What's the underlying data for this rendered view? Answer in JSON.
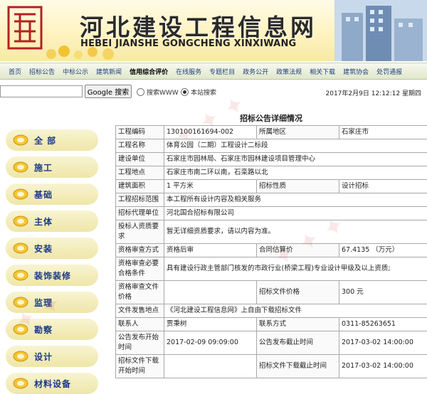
{
  "header": {
    "title": "河北建设工程信息网",
    "subtitle": "HEBEI JIANSHE GONGCHENG XINXIWANG"
  },
  "nav": {
    "items": [
      "首页",
      "招标公告",
      "中标公示",
      "建筑新闻",
      "信用综合评价",
      "在线服务",
      "专题栏目",
      "政务公开",
      "政策法规",
      "相关下载",
      "建筑协会",
      "处罚通报"
    ],
    "active_index": 4
  },
  "search": {
    "input_value": "",
    "button_label": "Google 搜索",
    "radio_www": "搜索WWW",
    "radio_site": "本站搜索",
    "selected": "site"
  },
  "datetime": "2017年2月9日 12:12:12 星期四",
  "sidebar": {
    "items": [
      "全 部",
      "施工",
      "基础",
      "主体",
      "安装",
      "装饰装修",
      "监理",
      "勘察",
      "设计",
      "材料设备"
    ]
  },
  "page_title": "招标公告详细情况",
  "detail": {
    "project_no_label": "工程编码",
    "project_no": "130100161694-002",
    "region_label": "所属地区",
    "region": "石家庄市",
    "project_name_label": "工程名称",
    "project_name": "体育公园（二期）工程设计二标段",
    "builder_label": "建设单位",
    "builder": "石家庄市园林局、石家庄市园林建设项目管理中心",
    "location_label": "工程地点",
    "location": "石家庄市南二环以南，石栾路以北",
    "area_label": "建筑面积",
    "area": "1 平方米",
    "nature_label": "招标性质",
    "nature": "设计招标",
    "scope_label": "工程招标范围",
    "scope": "本工程所有设计内容及相关服务",
    "agent_label": "招标代理单位",
    "agent": "河北国合招标有限公司",
    "qualification_label": "投标人资质要求",
    "qualification": "暂无详细资质要求，请以内容为准。",
    "review_method_label": "资格审查方式",
    "review_method": "资格后审",
    "estimate_label": "合同估算价",
    "estimate": "67.4135 （万元）",
    "review_conditions_label": "资格审查必要合格条件",
    "review_conditions": "具有建设行政主管部门核发的市政行业(桥梁工程)专业设计甲级及以上资质;",
    "review_doc_price_label": "资格审查文件价格",
    "review_doc_price": "",
    "tender_doc_price_label": "招标文件价格",
    "tender_doc_price": "300 元",
    "doc_release_label": "文件发售地点",
    "doc_release": "《河北建设工程信息网》上自由下载招标文件",
    "contact_label": "联系人",
    "contact": "贾秉树",
    "phone_label": "联系方式",
    "phone": "0311-85263651",
    "pub_start_label": "公告发布开始时间",
    "pub_start": "2017-02-09 09:09:00",
    "pub_end_label": "公告发布截止时间",
    "pub_end": "2017-03-02 14:00:00",
    "dl_start_label": "招标文件下载开始时间",
    "dl_start": "",
    "dl_end_label": "招标文件下载截止时间",
    "dl_end": "2017-03-02 14:00:00"
  },
  "colors": {
    "nav_link": "#1d3f7a",
    "sidebar_label": "#1b3a88",
    "table_border": "#a9a9a9"
  }
}
